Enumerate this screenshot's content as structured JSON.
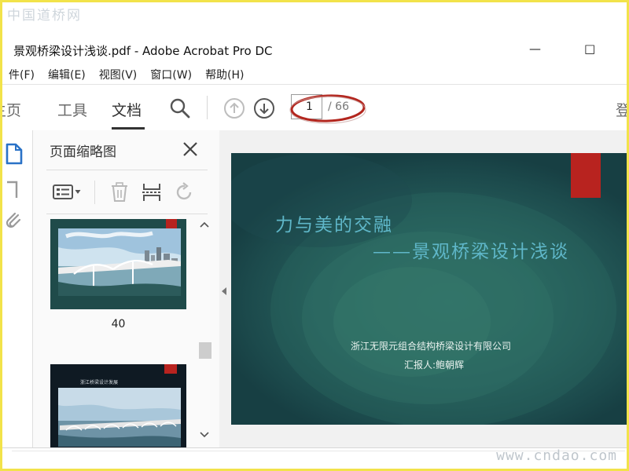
{
  "watermarks": {
    "top": "中国道桥网",
    "bottom": "www.cndao.com"
  },
  "window": {
    "title": "景观桥梁设计浅谈.pdf - Adobe Acrobat Pro DC",
    "minimize": "—",
    "maximize": "□"
  },
  "menu": [
    "件(F)",
    "编辑(E)",
    "视图(V)",
    "窗口(W)",
    "帮助(H)"
  ],
  "toolbar": {
    "tabs": [
      "主页",
      "工具",
      "文档"
    ],
    "active_tab": "文档",
    "page_current": "1",
    "page_total": "/ 66",
    "signin_label": "登"
  },
  "thumbnail_panel": {
    "title": "页面缩略图",
    "thumbs": [
      {
        "page": "40"
      }
    ],
    "thumb2_caption": "浙江桥梁设计发展"
  },
  "slide": {
    "title_line1": "力与美的交融",
    "title_line2": "——景观桥梁设计浅谈",
    "organization": "浙江无限元组合结构桥梁设计有限公司",
    "reporter": "汇报人:鲍朝辉",
    "accent_color": "#b8231f",
    "title_color": "#5fb7c9"
  },
  "annotation": {
    "color": "#b3261e"
  }
}
